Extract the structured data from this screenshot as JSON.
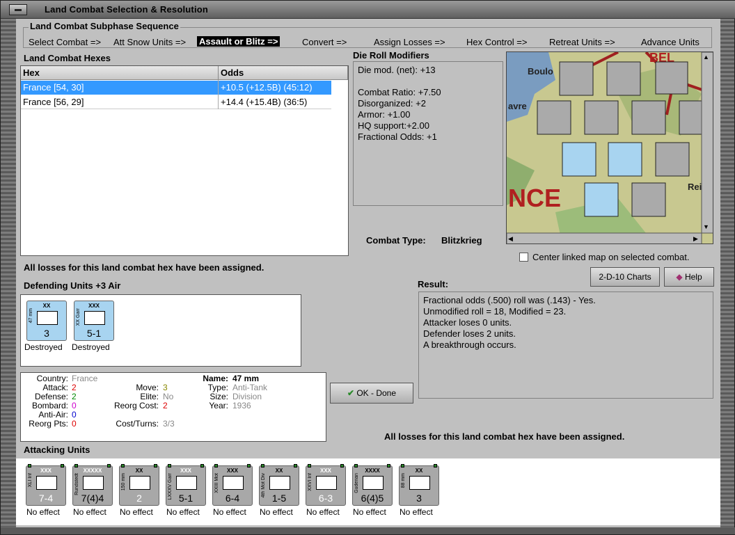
{
  "window": {
    "title": "Land Combat Selection & Resolution"
  },
  "phases": {
    "label": "Land Combat Subphase Sequence",
    "items": [
      "Select Combat =>",
      "Att Snow Units =>",
      "Assault or Blitz =>",
      "Convert =>",
      "Assign Losses =>",
      "Hex Control =>",
      "Retreat Units =>",
      "Advance Units"
    ],
    "active_index": 2
  },
  "hexes": {
    "title": "Land Combat Hexes",
    "col_hex": "Hex",
    "col_odds": "Odds",
    "rows": [
      {
        "hex": "France [54, 30]",
        "odds": "+10.5 (+12.5B) (45:12)"
      },
      {
        "hex": "France [56, 29]",
        "odds": "+14.4 (+15.4B) (36:5)"
      }
    ]
  },
  "modifiers": {
    "title": "Die Roll Modifiers",
    "lines": [
      "Die mod. (net): +13",
      "",
      "Combat Ratio: +7.50",
      "Disorganized: +2",
      "Armor: +1.00",
      "HQ support:+2.00",
      "Fractional Odds: +1"
    ]
  },
  "combat_type": {
    "label": "Combat Type:",
    "value": "Blitzkrieg"
  },
  "center_map": {
    "label": "Center linked map on selected combat."
  },
  "buttons": {
    "charts": "2-D-10 Charts",
    "help": "Help",
    "ok": "OK - Done"
  },
  "losses_msg": "All losses for this land combat hex have been assigned.",
  "defending": {
    "title": "Defending Units +3 Air",
    "units": [
      {
        "label": "Destroyed",
        "val": "3",
        "top": "XX",
        "side": "47 mm"
      },
      {
        "label": "Destroyed",
        "val": "5-1",
        "top": "XXX",
        "side": "XX Garr"
      }
    ]
  },
  "result": {
    "title": "Result:",
    "lines": [
      "Fractional odds (.500) roll was (.143)  - Yes.",
      "Unmodified roll = 18, Modified = 23.",
      "Attacker loses 0 units.",
      "Defender loses 2 units.",
      "A breakthrough occurs."
    ]
  },
  "details": {
    "country_k": "Country:",
    "country_v": "France",
    "attack_k": "Attack:",
    "attack_v": "2",
    "defense_k": "Defense:",
    "defense_v": "2",
    "bombard_k": "Bombard:",
    "bombard_v": "0",
    "aa_k": "Anti-Air:",
    "aa_v": "0",
    "reorg_k": "Reorg Pts:",
    "reorg_v": "0",
    "move_k": "Move:",
    "move_v": "3",
    "elite_k": "Elite:",
    "elite_v": "No",
    "reorgcost_k": "Reorg Cost:",
    "reorgcost_v": "2",
    "cost_k": "Cost/Turns:",
    "cost_v": "3/3",
    "name_k": "Name:",
    "name_v": "47 mm",
    "type_k": "Type:",
    "type_v": "Anti-Tank",
    "size_k": "Size:",
    "size_v": "Division",
    "year_k": "Year:",
    "year_v": "1936"
  },
  "attacking": {
    "title": "Attacking Units",
    "units": [
      {
        "val": "7-4",
        "top": "XXX",
        "side": "XLI Inf",
        "label": "No effect"
      },
      {
        "val": "7(4)4",
        "top": "XXXXX",
        "side": "Rundstedt",
        "label": "No effect"
      },
      {
        "val": "2",
        "top": "XX",
        "side": "150 mm",
        "label": "No effect"
      },
      {
        "val": "5-1",
        "top": "XXX",
        "side": "LXXXV Garr",
        "label": "No effect"
      },
      {
        "val": "6-4",
        "top": "XXX",
        "side": "XXIII Mot",
        "label": "No effect"
      },
      {
        "val": "1-5",
        "top": "XX",
        "side": "4th Mot Div",
        "label": "No effect"
      },
      {
        "val": "6-3",
        "top": "XXX",
        "side": "XXVI Inf",
        "label": "No effect"
      },
      {
        "val": "6(4)5",
        "top": "XXXX",
        "side": "Guderian",
        "label": "No effect"
      },
      {
        "val": "3",
        "top": "XX",
        "side": "88 mm",
        "label": "No effect"
      }
    ]
  },
  "map": {
    "town1": "Boulo",
    "town2": "avre",
    "text1": "NCE",
    "text2": "Rei",
    "text3": "BEL"
  },
  "colors": {
    "bg": "#c0c0c0",
    "select": "#3399ff",
    "panel_gray": "#c0c0c0"
  }
}
